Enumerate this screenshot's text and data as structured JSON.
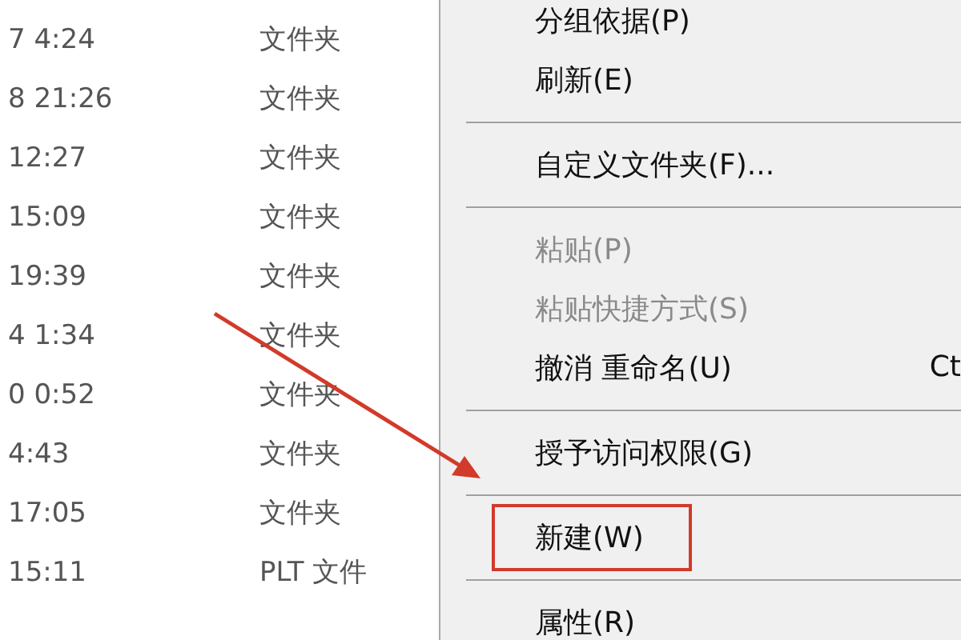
{
  "file_list": {
    "rows": [
      {
        "date": "7 4:24",
        "type": "文件夹"
      },
      {
        "date": "8 21:26",
        "type": "文件夹"
      },
      {
        "date": "12:27",
        "type": "文件夹"
      },
      {
        "date": "15:09",
        "type": "文件夹"
      },
      {
        "date": "19:39",
        "type": "文件夹"
      },
      {
        "date": "4 1:34",
        "type": "文件夹"
      },
      {
        "date": "0 0:52",
        "type": "文件夹"
      },
      {
        "date": "4:43",
        "type": "文件夹"
      },
      {
        "date": "17:05",
        "type": "文件夹"
      },
      {
        "date": "15:11",
        "type": "PLT 文件"
      }
    ]
  },
  "context_menu": {
    "items": [
      {
        "kind": "item",
        "label": "分组依据(P)",
        "disabled": false,
        "outlined": false
      },
      {
        "kind": "item",
        "label": "刷新(E)",
        "disabled": false,
        "outlined": false
      },
      {
        "kind": "separator"
      },
      {
        "kind": "item",
        "label": "自定义文件夹(F)...",
        "disabled": false,
        "outlined": false
      },
      {
        "kind": "separator"
      },
      {
        "kind": "item",
        "label": "粘贴(P)",
        "disabled": true,
        "outlined": false
      },
      {
        "kind": "item",
        "label": "粘贴快捷方式(S)",
        "disabled": true,
        "outlined": false
      },
      {
        "kind": "item",
        "label": "撤消 重命名(U)",
        "shortcut": "Ct",
        "disabled": false,
        "outlined": false
      },
      {
        "kind": "separator"
      },
      {
        "kind": "item",
        "label": "授予访问权限(G)",
        "disabled": false,
        "outlined": false
      },
      {
        "kind": "separator"
      },
      {
        "kind": "item",
        "label": "新建(W)",
        "disabled": false,
        "outlined": true
      },
      {
        "kind": "separator"
      },
      {
        "kind": "item",
        "label": "属性(R)",
        "disabled": false,
        "outlined": false
      }
    ]
  }
}
